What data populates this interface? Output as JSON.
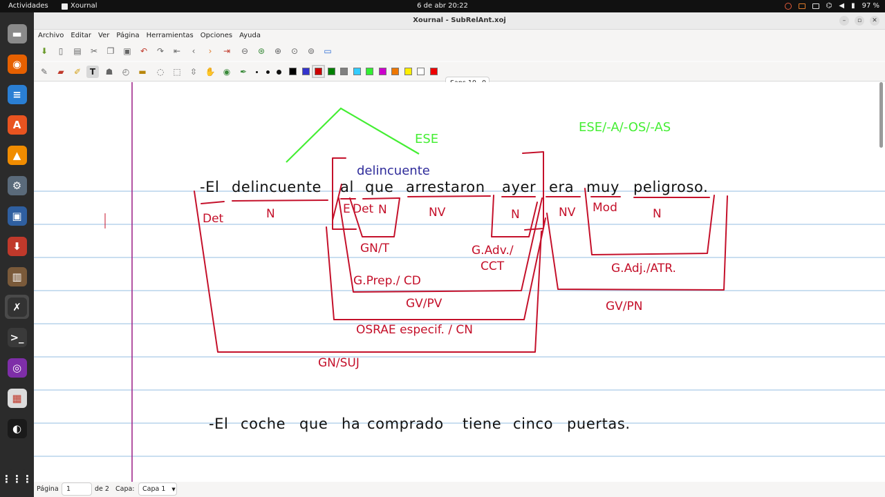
{
  "topbar": {
    "activities": "Actividades",
    "app_name": "Xournal",
    "clock": "6 de abr  20:22",
    "battery": "97 %"
  },
  "dock": {
    "items": [
      {
        "name": "files",
        "color": "#8a8a8a",
        "glyph": "▬"
      },
      {
        "name": "firefox",
        "color": "#e66000",
        "glyph": "◉"
      },
      {
        "name": "writer",
        "color": "#2a7fd4",
        "glyph": "≡"
      },
      {
        "name": "software",
        "color": "#e95420",
        "glyph": "A"
      },
      {
        "name": "vlc",
        "color": "#f08c00",
        "glyph": "▲"
      },
      {
        "name": "tools",
        "color": "#5a6a7a",
        "glyph": "⚙"
      },
      {
        "name": "virtualbox",
        "color": "#2f5fa0",
        "glyph": "▣"
      },
      {
        "name": "installer",
        "color": "#c0392b",
        "glyph": "⬇"
      },
      {
        "name": "library",
        "color": "#7a5a3a",
        "glyph": "▥"
      },
      {
        "name": "xournal",
        "color": "#333333",
        "glyph": "✗"
      },
      {
        "name": "terminal",
        "color": "#3a3a3a",
        "glyph": ">_"
      },
      {
        "name": "podcast",
        "color": "#7e2ea8",
        "glyph": "◎"
      },
      {
        "name": "screenshot",
        "color": "#dcdcdc",
        "glyph": "▦"
      },
      {
        "name": "obs",
        "color": "#1a1a1a",
        "glyph": "◐"
      },
      {
        "name": "apps-grid",
        "color": "#2b2b2b",
        "glyph": "⋮⋮⋮"
      }
    ]
  },
  "window": {
    "title": "Xournal - SubRelAnt.xoj"
  },
  "menu": [
    "Archivo",
    "Editar",
    "Ver",
    "Página",
    "Herramientas",
    "Opciones",
    "Ayuda"
  ],
  "toolbar": {
    "font": "Sans 10",
    "font_size_value": "0",
    "colors": [
      "#000000",
      "#3333cc",
      "#cc0000",
      "#008000",
      "#808080",
      "#33ccff",
      "#33ee33",
      "#cc00cc",
      "#ee7700",
      "#ffee00",
      "#ffffff",
      "#ee0000"
    ],
    "selected_color": "#cc0000"
  },
  "canvas": {
    "sentence1": {
      "words": [
        "-El",
        "delincuente",
        "al",
        "que",
        "arrestaron",
        "ayer",
        "era",
        "muy",
        "peligroso."
      ]
    },
    "sentence2": {
      "words": [
        "-El",
        "coche",
        "que",
        "ha",
        "comprado",
        "tiene",
        "cinco",
        "puertas."
      ]
    },
    "annotations": {
      "ese": "ESE",
      "ese_forms": "ESE/-A/-OS/-AS",
      "delincuente": "delincuente",
      "det": "Det",
      "n1": "N",
      "e": "E",
      "det2": "Det",
      "n2": "N",
      "nv1": "NV",
      "n3": "N",
      "nv2": "NV",
      "mod": "Mod",
      "n4": "N",
      "gn_t": "GN/T",
      "g_adv": "G.Adv./",
      "cct": "CCT",
      "g_prep": "G.Prep./ CD",
      "g_adj": "G.Adj./ATR.",
      "gv_pv": "GV/PV",
      "gv_pn": "GV/PN",
      "osrae": "OSRAE especif. / CN",
      "gn_suj": "GN/SUJ"
    },
    "colors": {
      "red_ink": "#c4102a",
      "green_ink": "#44ee33",
      "blue_ink": "#2e2b9a",
      "ruling": "#a9cbe8",
      "margin": "#a0288c"
    }
  },
  "status": {
    "page_label": "Página",
    "page_value": "1",
    "of_pages": "de 2",
    "layer_label": "Capa:",
    "layer_value": "Capa 1"
  }
}
